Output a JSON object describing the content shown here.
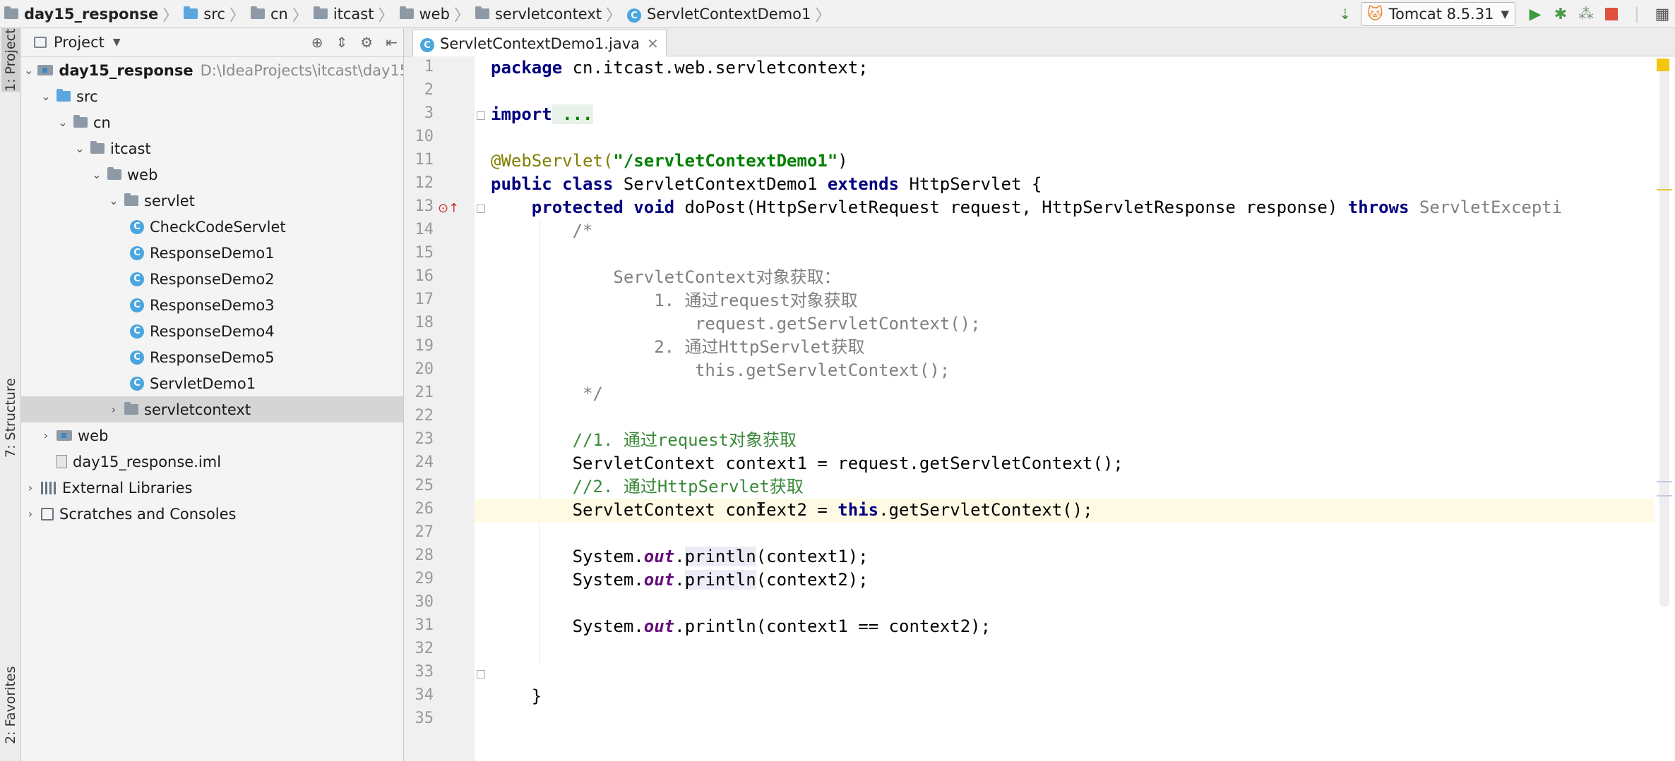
{
  "breadcrumbs": [
    {
      "label": "day15_response",
      "icon": "module-folder-icon"
    },
    {
      "label": "src",
      "icon": "source-folder-icon"
    },
    {
      "label": "cn",
      "icon": "folder-icon"
    },
    {
      "label": "itcast",
      "icon": "folder-icon"
    },
    {
      "label": "web",
      "icon": "folder-icon"
    },
    {
      "label": "servletcontext",
      "icon": "folder-icon"
    },
    {
      "label": "ServletContextDemo1",
      "icon": "class-icon"
    }
  ],
  "run": {
    "config_label": "Tomcat 8.5.31"
  },
  "left_stripe": {
    "project_tab": "1: Project",
    "structure_tab": "7: Structure",
    "favorites_tab": "2: Favorites"
  },
  "project_panel": {
    "title": "Project"
  },
  "tree": [
    {
      "label": "day15_response",
      "path": "D:\\IdeaProjects\\itcast\\day15"
    },
    {
      "label": "src"
    },
    {
      "label": "cn"
    },
    {
      "label": "itcast"
    },
    {
      "label": "web"
    },
    {
      "label": "servlet"
    },
    {
      "label": "CheckCodeServlet"
    },
    {
      "label": "ResponseDemo1"
    },
    {
      "label": "ResponseDemo2"
    },
    {
      "label": "ResponseDemo3"
    },
    {
      "label": "ResponseDemo4"
    },
    {
      "label": "ResponseDemo5"
    },
    {
      "label": "ServletDemo1"
    },
    {
      "label": "servletcontext"
    },
    {
      "label": "web"
    },
    {
      "label": "day15_response.iml"
    },
    {
      "label": "External Libraries"
    },
    {
      "label": "Scratches and Consoles"
    }
  ],
  "editor": {
    "tab_label": "ServletContextDemo1.java",
    "line_numbers": [
      "1",
      "2",
      "3",
      "10",
      "11",
      "12",
      "13",
      "14",
      "15",
      "16",
      "17",
      "18",
      "19",
      "20",
      "21",
      "22",
      "23",
      "24",
      "25",
      "26",
      "27",
      "28",
      "29",
      "30",
      "31",
      "32",
      "33",
      "34",
      "35"
    ],
    "code": {
      "l1_kw": "package",
      "l1_rest": " cn.itcast.web.servletcontext;",
      "l3_kw": "import",
      "l3_rest": " ...",
      "l11_ann": "@WebServlet(",
      "l11_str": "\"/servletContextDemo1\"",
      "l11_end": ")",
      "l12_kw1": "public",
      "l12_kw2": " class",
      "l12_mid": " ServletContextDemo1 ",
      "l12_kw3": "extends",
      "l12_end": " HttpServlet {",
      "l13_kw1": "    protected",
      "l13_kw2": " void",
      "l13_mid": " doPost(HttpServletRequest request, HttpServletResponse response) ",
      "l13_kw3": "throws",
      "l13_end": " ServletExcepti",
      "l14": "        /*",
      "l16": "            ServletContext对象获取：",
      "l17": "                1. 通过request对象获取",
      "l18": "                    request.getServletContext();",
      "l19": "                2. 通过HttpServlet获取",
      "l20": "                    this.getServletContext();",
      "l21": "         */",
      "l23": "        //1. 通过request对象获取",
      "l24": "        ServletContext context1 = request.getServletContext();",
      "l25": "        //2. 通过HttpServlet获取",
      "l26_a": "        ServletContext context2 = ",
      "l26_kw": "this",
      "l26_b": ".getServletContext();",
      "sys": "        System.",
      "out": "out",
      "dot": ".",
      "println": "println",
      "l28_end": "(context1);",
      "l29_end": "(context2);",
      "l31_end": "(context1 == context2);",
      "l34": "    }"
    }
  }
}
